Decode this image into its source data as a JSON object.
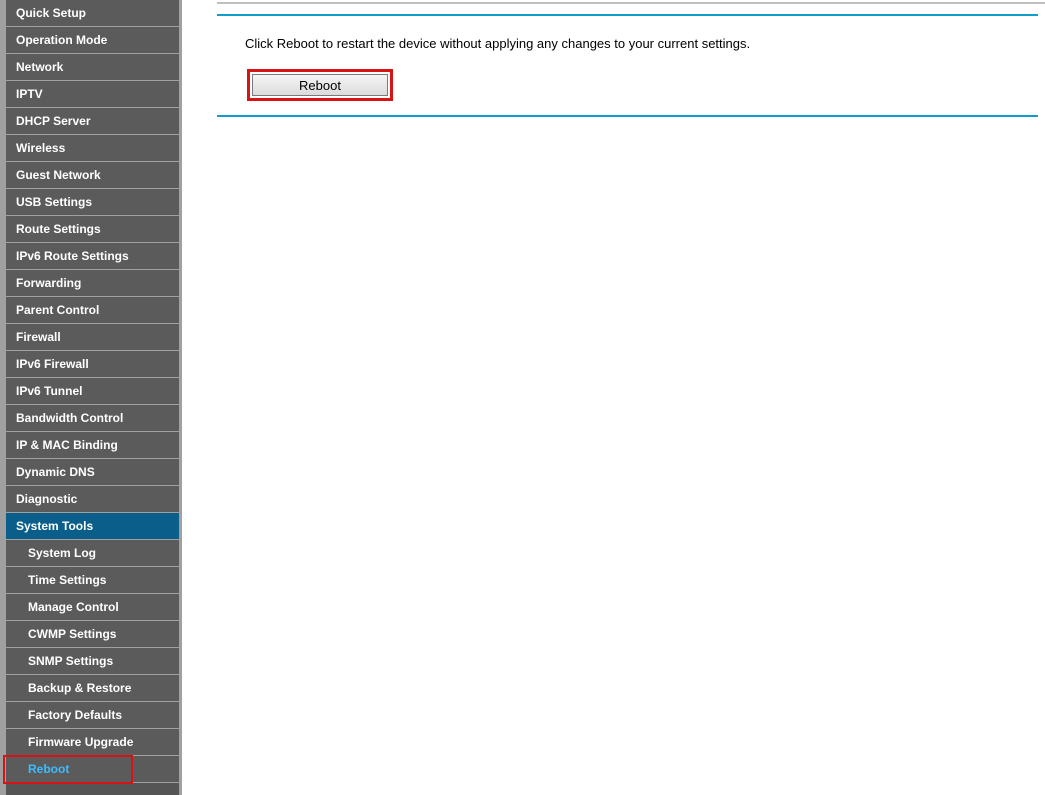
{
  "sidebar": {
    "items": [
      {
        "label": "Quick Setup"
      },
      {
        "label": "Operation Mode"
      },
      {
        "label": "Network"
      },
      {
        "label": "IPTV"
      },
      {
        "label": "DHCP Server"
      },
      {
        "label": "Wireless"
      },
      {
        "label": "Guest Network"
      },
      {
        "label": "USB Settings"
      },
      {
        "label": "Route Settings"
      },
      {
        "label": "IPv6 Route Settings"
      },
      {
        "label": "Forwarding"
      },
      {
        "label": "Parent Control"
      },
      {
        "label": "Firewall"
      },
      {
        "label": "IPv6 Firewall"
      },
      {
        "label": "IPv6 Tunnel"
      },
      {
        "label": "Bandwidth Control"
      },
      {
        "label": "IP & MAC Binding"
      },
      {
        "label": "Dynamic DNS"
      },
      {
        "label": "Diagnostic"
      },
      {
        "label": "System Tools"
      }
    ],
    "subitems": [
      {
        "label": "System Log"
      },
      {
        "label": "Time Settings"
      },
      {
        "label": "Manage Control"
      },
      {
        "label": "CWMP Settings"
      },
      {
        "label": "SNMP Settings"
      },
      {
        "label": "Backup & Restore"
      },
      {
        "label": "Factory Defaults"
      },
      {
        "label": "Firmware Upgrade"
      },
      {
        "label": "Reboot"
      }
    ]
  },
  "content": {
    "instruction": "Click Reboot to restart the device without applying any changes to your current settings.",
    "reboot_label": "Reboot"
  }
}
